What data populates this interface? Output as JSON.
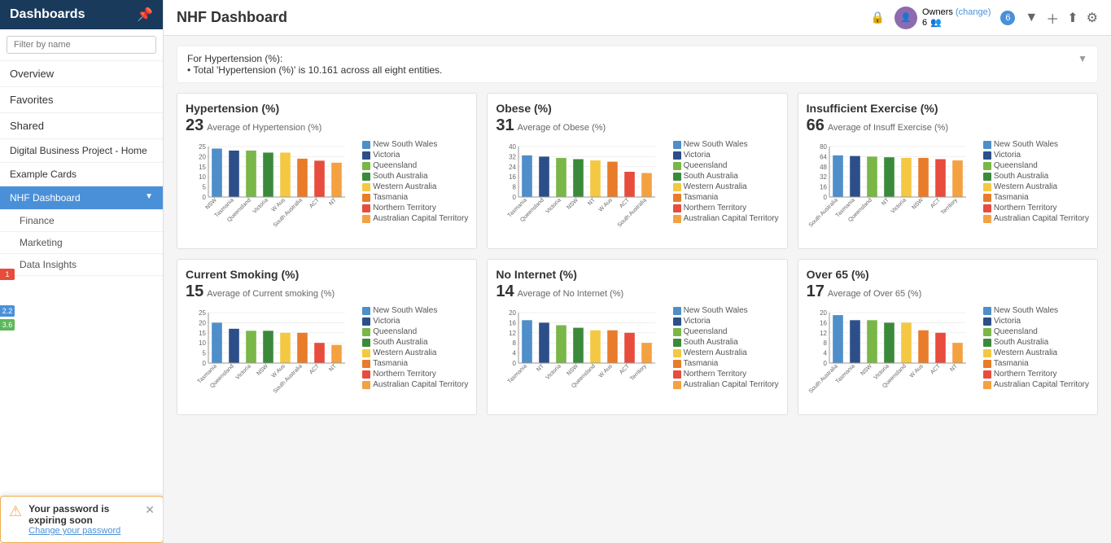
{
  "sidebar": {
    "title": "Dashboards",
    "search_placeholder": "Filter by name",
    "nav": [
      {
        "label": "Overview",
        "id": "overview"
      },
      {
        "label": "Favorites",
        "id": "favorites"
      },
      {
        "label": "Shared",
        "id": "shared"
      }
    ],
    "group_items": [
      {
        "label": "Digital Business Project - Home",
        "id": "digital-business"
      },
      {
        "label": "Example Cards",
        "id": "example-cards"
      }
    ],
    "active_item": {
      "label": "NHF Dashboard",
      "id": "nhf-dashboard"
    },
    "sub_items": [
      {
        "label": "Finance",
        "id": "finance"
      },
      {
        "label": "Marketing",
        "id": "marketing"
      },
      {
        "label": "Data Insights",
        "id": "data-insights"
      }
    ]
  },
  "topbar": {
    "title": "NHF Dashboard",
    "owners_label": "Owners",
    "change_label": "(change)",
    "owners_count": "6",
    "owners_sub": "6 owners"
  },
  "top_notice": {
    "line1": "For Hypertension (%):",
    "line2": "• Total 'Hypertension (%)' is 10.161 across all eight entities."
  },
  "legend_items": [
    {
      "label": "New South Wales",
      "color": "#4e8ec9"
    },
    {
      "label": "Victoria",
      "color": "#2c4f8a"
    },
    {
      "label": "Queensland",
      "color": "#7ab648"
    },
    {
      "label": "South Australia",
      "color": "#3b8a3b"
    },
    {
      "label": "Western Australia",
      "color": "#f4c842"
    },
    {
      "label": "Tasmania",
      "color": "#e87c2b"
    },
    {
      "label": "Northern Territory",
      "color": "#e74c3c"
    },
    {
      "label": "Australian Capital Territory",
      "color": "#f4a142"
    }
  ],
  "charts": [
    {
      "id": "hypertension",
      "title": "Hypertension (%)",
      "avg_num": "23",
      "avg_label": "Average of Hypertension (%)",
      "y_max": 25,
      "bars": [
        24,
        23,
        23,
        22,
        22,
        19,
        18,
        17
      ],
      "x_labels": [
        "New South Wales",
        "Tasmania",
        "Queensland",
        "Victoria",
        "Western Australia",
        "South Australia",
        "Australian Capital",
        "Northern Territory"
      ]
    },
    {
      "id": "obese",
      "title": "Obese (%)",
      "avg_num": "31",
      "avg_label": "Average of Obese (%)",
      "y_max": 40,
      "bars": [
        33,
        32,
        31,
        30,
        29,
        28,
        20,
        19
      ],
      "x_labels": [
        "Tasmania",
        "Queensland",
        "Victoria",
        "New South Wales",
        "Northern Territory",
        "Western Australia",
        "Australian Capital",
        "South Australia"
      ]
    },
    {
      "id": "insufficient-exercise",
      "title": "Insufficient Exercise (%)",
      "avg_num": "66",
      "avg_label": "Average of Insuff Exercise (%)",
      "y_max": 80,
      "bars": [
        66,
        65,
        64,
        63,
        62,
        62,
        60,
        58
      ],
      "x_labels": [
        "South Australia",
        "Tasmania",
        "Queensland",
        "Northern Territory",
        "Victoria",
        "New South Wales",
        "Australian Capital",
        "Territory"
      ]
    },
    {
      "id": "current-smoking",
      "title": "Current Smoking (%)",
      "avg_num": "15",
      "avg_label": "Average of Current smoking (%)",
      "y_max": 25,
      "bars": [
        20,
        17,
        16,
        16,
        15,
        15,
        10,
        9
      ],
      "x_labels": [
        "Tasmania",
        "Queensland",
        "Victoria",
        "New South Wales",
        "Western Australia",
        "South Australia",
        "Australian Capital",
        "Northern Territory"
      ]
    },
    {
      "id": "no-internet",
      "title": "No Internet (%)",
      "avg_num": "14",
      "avg_label": "Average of No Internet (%)",
      "y_max": 20,
      "bars": [
        17,
        16,
        15,
        14,
        13,
        13,
        12,
        8
      ],
      "x_labels": [
        "Tasmania",
        "Northern Territory",
        "Victoria",
        "New South Wales",
        "Queensland",
        "Western Australia",
        "Australian Capital",
        "Territory"
      ]
    },
    {
      "id": "over-65",
      "title": "Over 65 (%)",
      "avg_num": "17",
      "avg_label": "Average of Over 65 (%)",
      "y_max": 20,
      "bars": [
        19,
        17,
        17,
        16,
        16,
        13,
        12,
        8
      ],
      "x_labels": [
        "South Australia",
        "Tasmania",
        "New South Wales",
        "Victoria",
        "Queensland",
        "Western Australia",
        "Australian Capital",
        "Northern Territory"
      ]
    }
  ],
  "password_warning": {
    "title": "Your password is expiring soon",
    "body": "Change your password"
  }
}
